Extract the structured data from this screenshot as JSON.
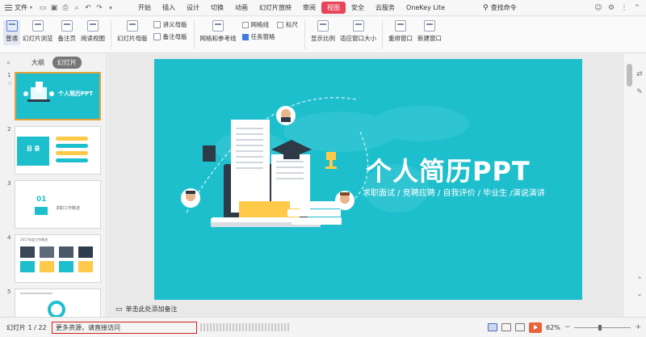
{
  "menubar": {
    "file_label": "文件",
    "tabs": [
      "开始",
      "插入",
      "设计",
      "切换",
      "动画",
      "幻灯片放映",
      "审阅",
      "视图",
      "安全",
      "云服务",
      "OneKey Lite"
    ],
    "active_tab": "视图",
    "search_label": "查找命令"
  },
  "ribbon": {
    "normal": "普通",
    "slide_browse": "幻灯片浏览",
    "notes_page": "备注页",
    "reading_view": "阅读视图",
    "slide_master": "幻灯片母版",
    "handout_master": "讲义母版",
    "notes_master": "备注母版",
    "grid_guides": "网格和参考线",
    "gridlines": "网格线",
    "ruler": "标尺",
    "task_pane": "任务窗格",
    "zoom": "显示比例",
    "fit_window": "适应窗口大小",
    "rearrange_windows": "重排窗口",
    "new_window": "新建窗口"
  },
  "left_panel": {
    "tab_outline": "大纲",
    "tab_slides": "幻灯片",
    "slides": [
      {
        "num": "1",
        "title": "个人简历PPT"
      },
      {
        "num": "2",
        "title": "目 录"
      },
      {
        "num": "3",
        "title": "01",
        "sub": "求职工作概述"
      },
      {
        "num": "4",
        "title": "2017年度工作概述"
      },
      {
        "num": "5",
        "title": ""
      }
    ]
  },
  "slide": {
    "title": "个人简历PPT",
    "subtitle": "求职面试 / 竞聘应聘 / 自我评价 / 毕业生 /演说演讲",
    "bg_color": "#1ebfcd"
  },
  "notes_placeholder": "单击此处添加备注",
  "statusbar": {
    "slide_count": "幻灯片 1 / 22",
    "notice": "更多资源，请直接访问",
    "zoom": "62%"
  }
}
